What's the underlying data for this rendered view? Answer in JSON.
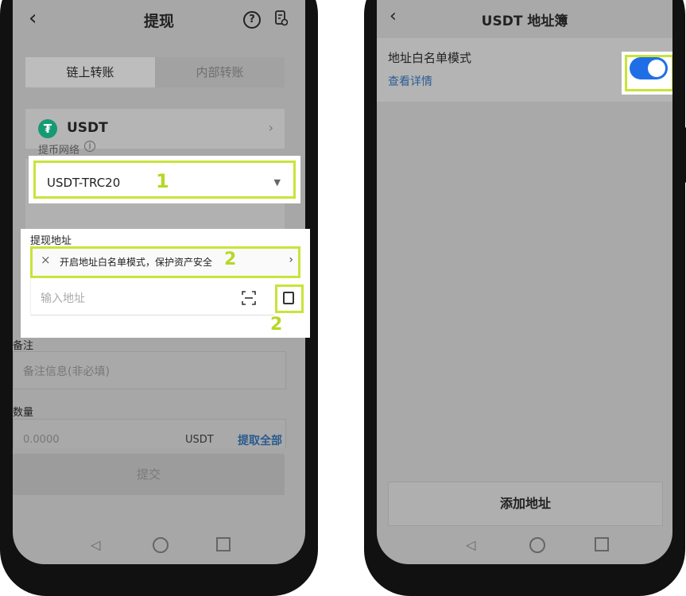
{
  "left_screen": {
    "header": {
      "title": "提现",
      "help_icon": "help-circle-icon",
      "record_icon": "record-history-icon"
    },
    "tabs": [
      {
        "label": "链上转账",
        "active": true
      },
      {
        "label": "内部转账",
        "active": false
      }
    ],
    "coin": {
      "name": "USDT",
      "icon": "tether-logo-icon"
    },
    "network": {
      "label": "提币网络",
      "value": "USDT-TRC20"
    },
    "address": {
      "label": "提现地址",
      "whitelist_banner": "开启地址白名单模式，保护资产安全",
      "placeholder": "输入地址"
    },
    "memo": {
      "label": "备注",
      "placeholder": "备注信息(非必填)"
    },
    "quantity": {
      "label": "数量",
      "placeholder": "0.0000",
      "unit": "USDT",
      "all_label": "提取全部"
    },
    "submit_label": "提交",
    "steps": {
      "network_step": "1",
      "address_step": "2",
      "book_step": "2"
    }
  },
  "right_screen": {
    "header": {
      "title": "USDT 地址簿"
    },
    "whitelist": {
      "title": "地址白名单模式",
      "detail_link": "查看详情",
      "enabled": true
    },
    "add_button_label": "添加地址"
  },
  "colors": {
    "highlight": "#c8e43a",
    "toggle_on": "#1f6ee6",
    "link": "#2b5d93",
    "tether": "#169a74"
  }
}
